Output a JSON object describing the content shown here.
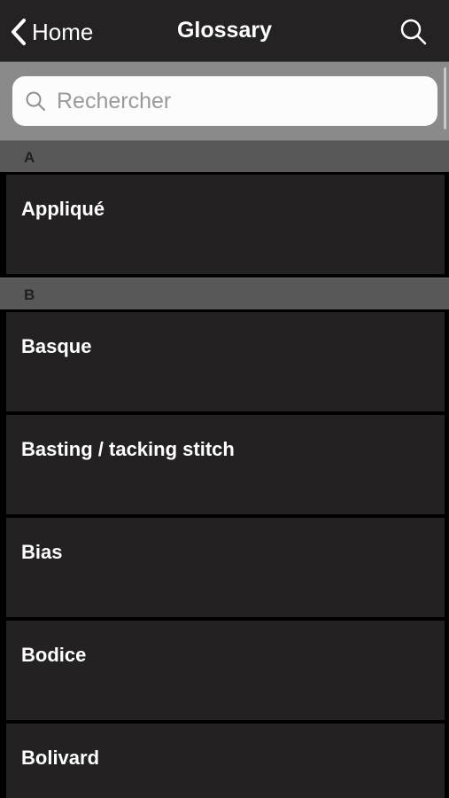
{
  "navbar": {
    "back_label": "Home",
    "title": "Glossary"
  },
  "search": {
    "placeholder": "Rechercher"
  },
  "sections": [
    {
      "letter": "A",
      "items": [
        "Appliqué"
      ]
    },
    {
      "letter": "B",
      "items": [
        "Basque",
        "Basting / tacking stitch",
        "Bias",
        "Bodice",
        "Bolivard"
      ]
    }
  ],
  "icons": {
    "back": "chevron-left-icon",
    "nav_search": "search-icon",
    "field_search": "search-icon"
  },
  "colors": {
    "navbar_bg": "#242223",
    "search_area_bg": "#8a8a8a",
    "section_header_bg": "#585858",
    "item_bg": "#232122",
    "text": "#ffffff"
  }
}
